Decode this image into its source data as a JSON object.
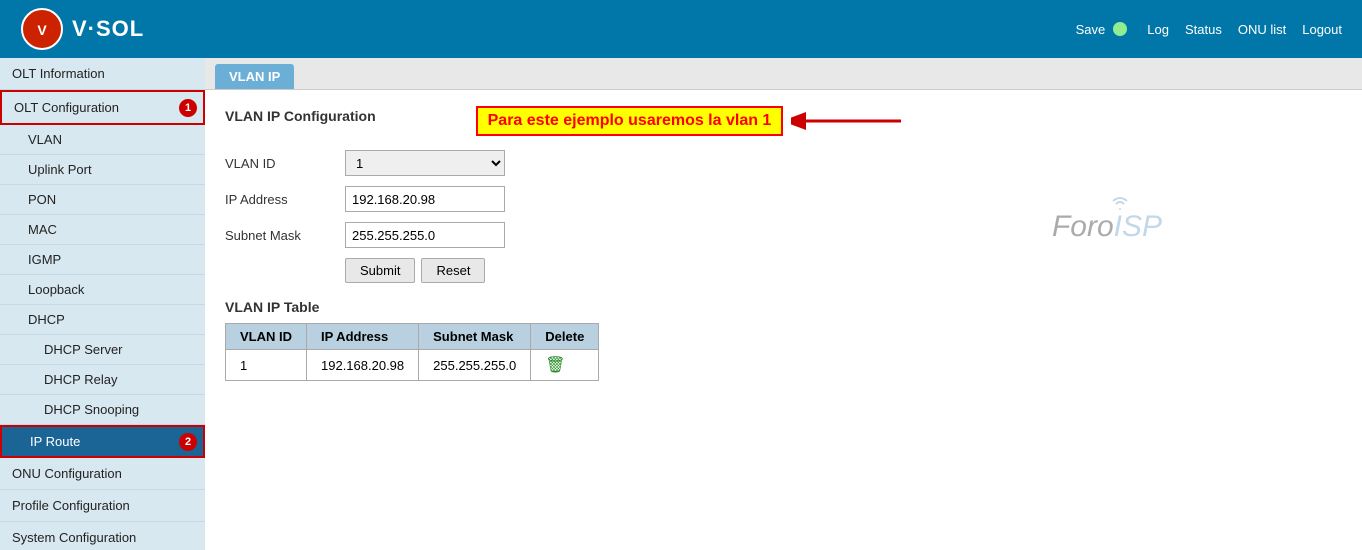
{
  "header": {
    "logo_text": "V·SOL",
    "save_label": "Save",
    "status_color": "#90ee90",
    "links": [
      "Log",
      "Status",
      "ONU list",
      "Logout"
    ]
  },
  "sidebar": {
    "items": [
      {
        "id": "olt-information",
        "label": "OLT Information",
        "level": 0,
        "active": false,
        "highlighted": false
      },
      {
        "id": "olt-configuration",
        "label": "OLT Configuration",
        "level": 0,
        "active": false,
        "highlighted": true,
        "badge": "1"
      },
      {
        "id": "vlan",
        "label": "VLAN",
        "level": 1,
        "active": false
      },
      {
        "id": "uplink-port",
        "label": "Uplink Port",
        "level": 1,
        "active": false
      },
      {
        "id": "pon",
        "label": "PON",
        "level": 1,
        "active": false
      },
      {
        "id": "mac",
        "label": "MAC",
        "level": 1,
        "active": false
      },
      {
        "id": "igmp",
        "label": "IGMP",
        "level": 1,
        "active": false
      },
      {
        "id": "loopback",
        "label": "Loopback",
        "level": 1,
        "active": false
      },
      {
        "id": "dhcp",
        "label": "DHCP",
        "level": 1,
        "active": false
      },
      {
        "id": "dhcp-server",
        "label": "DHCP Server",
        "level": 2,
        "active": false
      },
      {
        "id": "dhcp-relay",
        "label": "DHCP Relay",
        "level": 2,
        "active": false
      },
      {
        "id": "dhcp-snooping",
        "label": "DHCP Snooping",
        "level": 2,
        "active": false
      },
      {
        "id": "ip-route",
        "label": "IP Route",
        "level": 1,
        "active": true,
        "highlighted": true,
        "badge": "2"
      },
      {
        "id": "onu-configuration",
        "label": "ONU Configuration",
        "level": 0,
        "active": false
      },
      {
        "id": "profile-configuration",
        "label": "Profile Configuration",
        "level": 0,
        "active": false
      },
      {
        "id": "system-configuration",
        "label": "System Configuration",
        "level": 0,
        "active": false
      }
    ]
  },
  "tab": {
    "label": "VLAN IP"
  },
  "content": {
    "section_title": "VLAN IP Configuration",
    "annotation": "Para este ejemplo usaremos la vlan 1",
    "form": {
      "vlan_id_label": "VLAN ID",
      "vlan_id_value": "1",
      "ip_address_label": "IP Address",
      "ip_address_value": "192.168.20.98",
      "subnet_mask_label": "Subnet Mask",
      "subnet_mask_value": "255.255.255.0",
      "submit_label": "Submit",
      "reset_label": "Reset"
    },
    "table": {
      "title": "VLAN IP Table",
      "columns": [
        "VLAN ID",
        "IP Address",
        "Subnet Mask",
        "Delete"
      ],
      "rows": [
        {
          "vlan_id": "1",
          "ip_address": "192.168.20.98",
          "subnet_mask": "255.255.255.0"
        }
      ]
    }
  },
  "foro_isp": {
    "text1": "Foro",
    "text2": "ISP"
  }
}
